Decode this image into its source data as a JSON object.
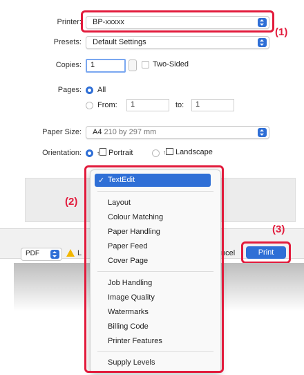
{
  "printer": {
    "label": "Printer:",
    "value": "BP-xxxxx"
  },
  "presets": {
    "label": "Presets:",
    "value": "Default Settings"
  },
  "copies": {
    "label": "Copies:",
    "value": "1",
    "two_sided": "Two-Sided"
  },
  "pages": {
    "label": "Pages:",
    "all": "All",
    "from_label": "From:",
    "from_value": "1",
    "to_label": "to:",
    "to_value": "1"
  },
  "paper_size": {
    "label": "Paper Size:",
    "size": "A4",
    "dims": "210 by 297 mm"
  },
  "orientation": {
    "label": "Orientation:",
    "portrait": "Portrait",
    "landscape": "Landscape",
    "arrow": "↑"
  },
  "menu": {
    "selected": "TextEdit",
    "checkmark": "✓",
    "group1": [
      "Layout",
      "Colour Matching",
      "Paper Handling",
      "Paper Feed",
      "Cover Page"
    ],
    "group2": [
      "Job Handling",
      "Image Quality",
      "Watermarks",
      "Billing Code",
      "Printer Features"
    ],
    "group3": [
      "Supply Levels"
    ]
  },
  "footer": {
    "pdf": "PDF",
    "warning_partial": "L",
    "cancel_partial": "ncel",
    "print": "Print"
  },
  "callouts": {
    "c1": "(1)",
    "c2": "(2)",
    "c3": "(3)"
  },
  "colors": {
    "accent": "#2f6fd6",
    "annotation": "#e21b3c",
    "warning": "#f2b600"
  }
}
